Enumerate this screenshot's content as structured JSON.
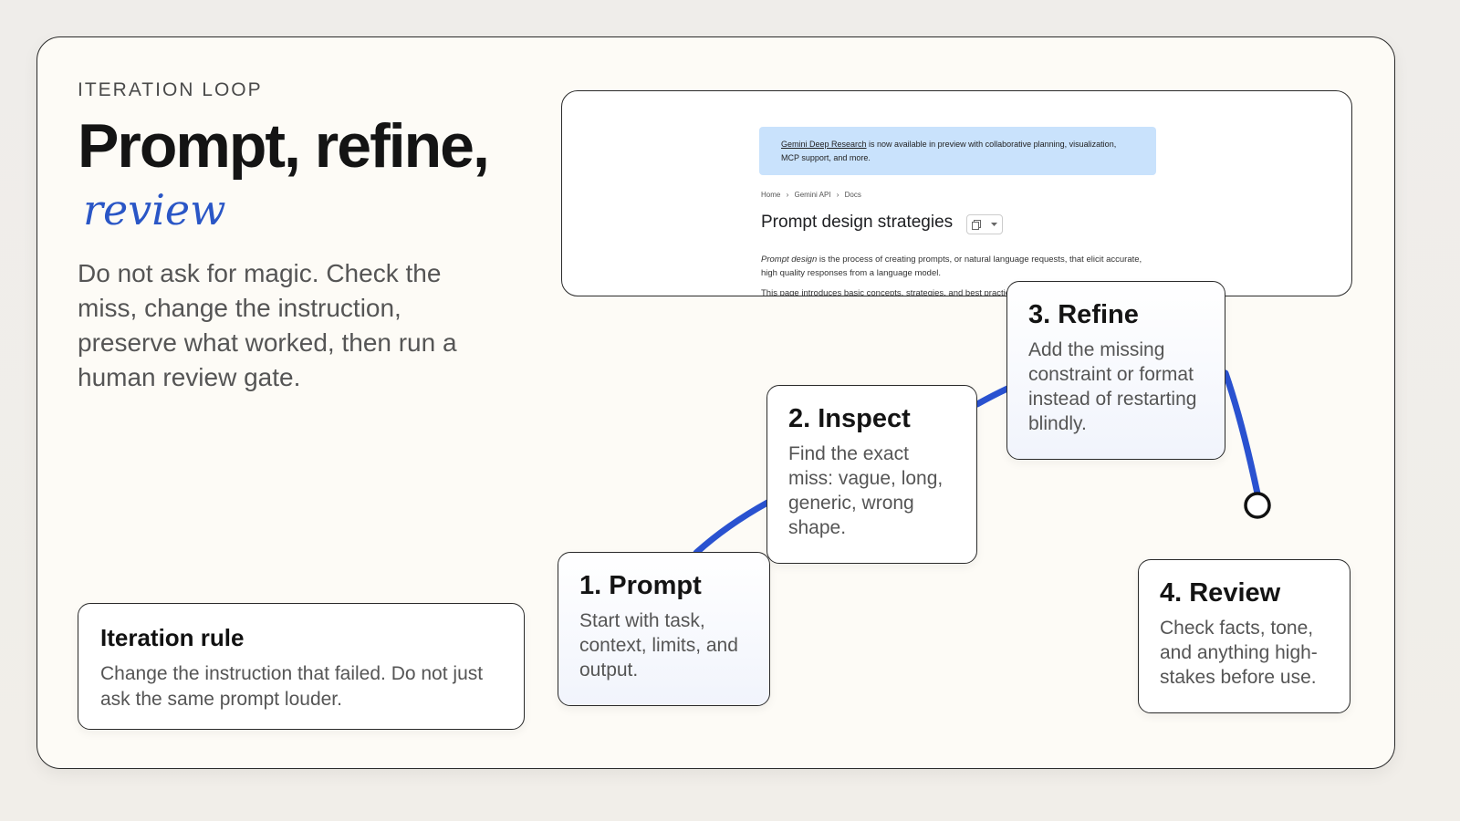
{
  "header": {
    "eyebrow": "ITERATION LOOP",
    "title": "Prompt, refine,",
    "title_italic": "review",
    "lede": "Do not ask for magic. Check the miss, change the instruction, preserve what worked, then run a human review gate."
  },
  "rule": {
    "heading": "Iteration rule",
    "body": "Change the instruction that failed. Do not just ask the same prompt louder."
  },
  "screenshot": {
    "banner_link": "Gemini Deep Research",
    "banner_text": " is now available in preview with collaborative planning, visualization, MCP support, and more.",
    "breadcrumbs": [
      "Home",
      "Gemini API",
      "Docs"
    ],
    "breadcrumb_sep": "›",
    "doc_title": "Prompt design strategies",
    "para_term": "Prompt design",
    "para_rest": " is the process of creating prompts, or natural language requests, that elicit accurate, high quality responses from a language model.",
    "para2": "This page introduces basic concepts, strategies, and best practices"
  },
  "steps": [
    {
      "title": "1. Prompt",
      "body": "Start with task, context, limits, and output."
    },
    {
      "title": "2. Inspect",
      "body": "Find the exact miss: vague, long, generic, wrong shape."
    },
    {
      "title": "3. Refine",
      "body": "Add the missing constraint or format instead of restarting blindly."
    },
    {
      "title": "4. Review",
      "body": "Check facts, tone, and anything high-stakes before use."
    }
  ],
  "colors": {
    "accent": "#2a56c6",
    "connector": "#2a52d0",
    "background": "#fdfbf6"
  }
}
